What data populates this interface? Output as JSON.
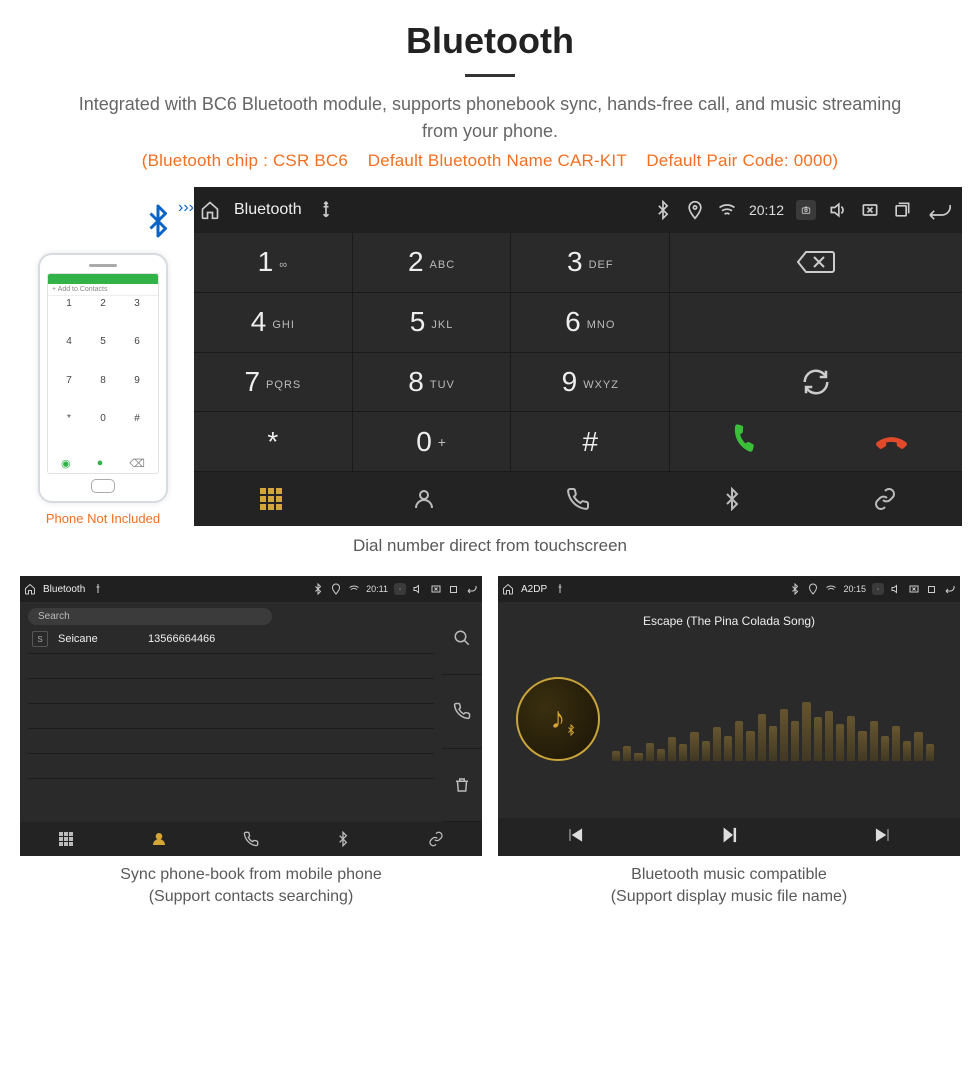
{
  "header": {
    "title": "Bluetooth",
    "subtitle": "Integrated with BC6 Bluetooth module, supports phonebook sync, hands-free call, and music streaming from your phone.",
    "specs": "(Bluetooth chip : CSR BC6    Default Bluetooth Name CAR-KIT    Default Pair Code: 0000)"
  },
  "phone_mock": {
    "add_label": "+  Add to Contacts",
    "caption": "Phone Not Included"
  },
  "main_panel": {
    "status": {
      "title": "Bluetooth",
      "time": "20:12"
    },
    "keys": [
      {
        "num": "1",
        "let": "∞"
      },
      {
        "num": "2",
        "let": "ABC"
      },
      {
        "num": "3",
        "let": "DEF"
      },
      {
        "num": "4",
        "let": "GHI"
      },
      {
        "num": "5",
        "let": "JKL"
      },
      {
        "num": "6",
        "let": "MNO"
      },
      {
        "num": "7",
        "let": "PQRS"
      },
      {
        "num": "8",
        "let": "TUV"
      },
      {
        "num": "9",
        "let": "WXYZ"
      },
      {
        "num": "*",
        "let": ""
      },
      {
        "num": "0",
        "let": "+"
      },
      {
        "num": "#",
        "let": ""
      }
    ],
    "caption": "Dial number direct from touchscreen"
  },
  "contacts_panel": {
    "status": {
      "title": "Bluetooth",
      "time": "20:11"
    },
    "search_placeholder": "Search",
    "contact": {
      "initial": "S",
      "name": "Seicane",
      "number": "13566664466"
    },
    "caption_line1": "Sync phone-book from mobile phone",
    "caption_line2": "(Support contacts searching)"
  },
  "music_panel": {
    "status": {
      "title": "A2DP",
      "time": "20:15"
    },
    "song": "Escape (The Pina Colada Song)",
    "eq_heights": [
      12,
      18,
      10,
      22,
      14,
      28,
      20,
      34,
      24,
      40,
      30,
      48,
      36,
      56,
      42,
      62,
      48,
      70,
      52,
      60,
      44,
      54,
      36,
      48,
      30,
      42,
      24,
      34,
      20
    ],
    "caption_line1": "Bluetooth music compatible",
    "caption_line2": "(Support display music file name)"
  }
}
